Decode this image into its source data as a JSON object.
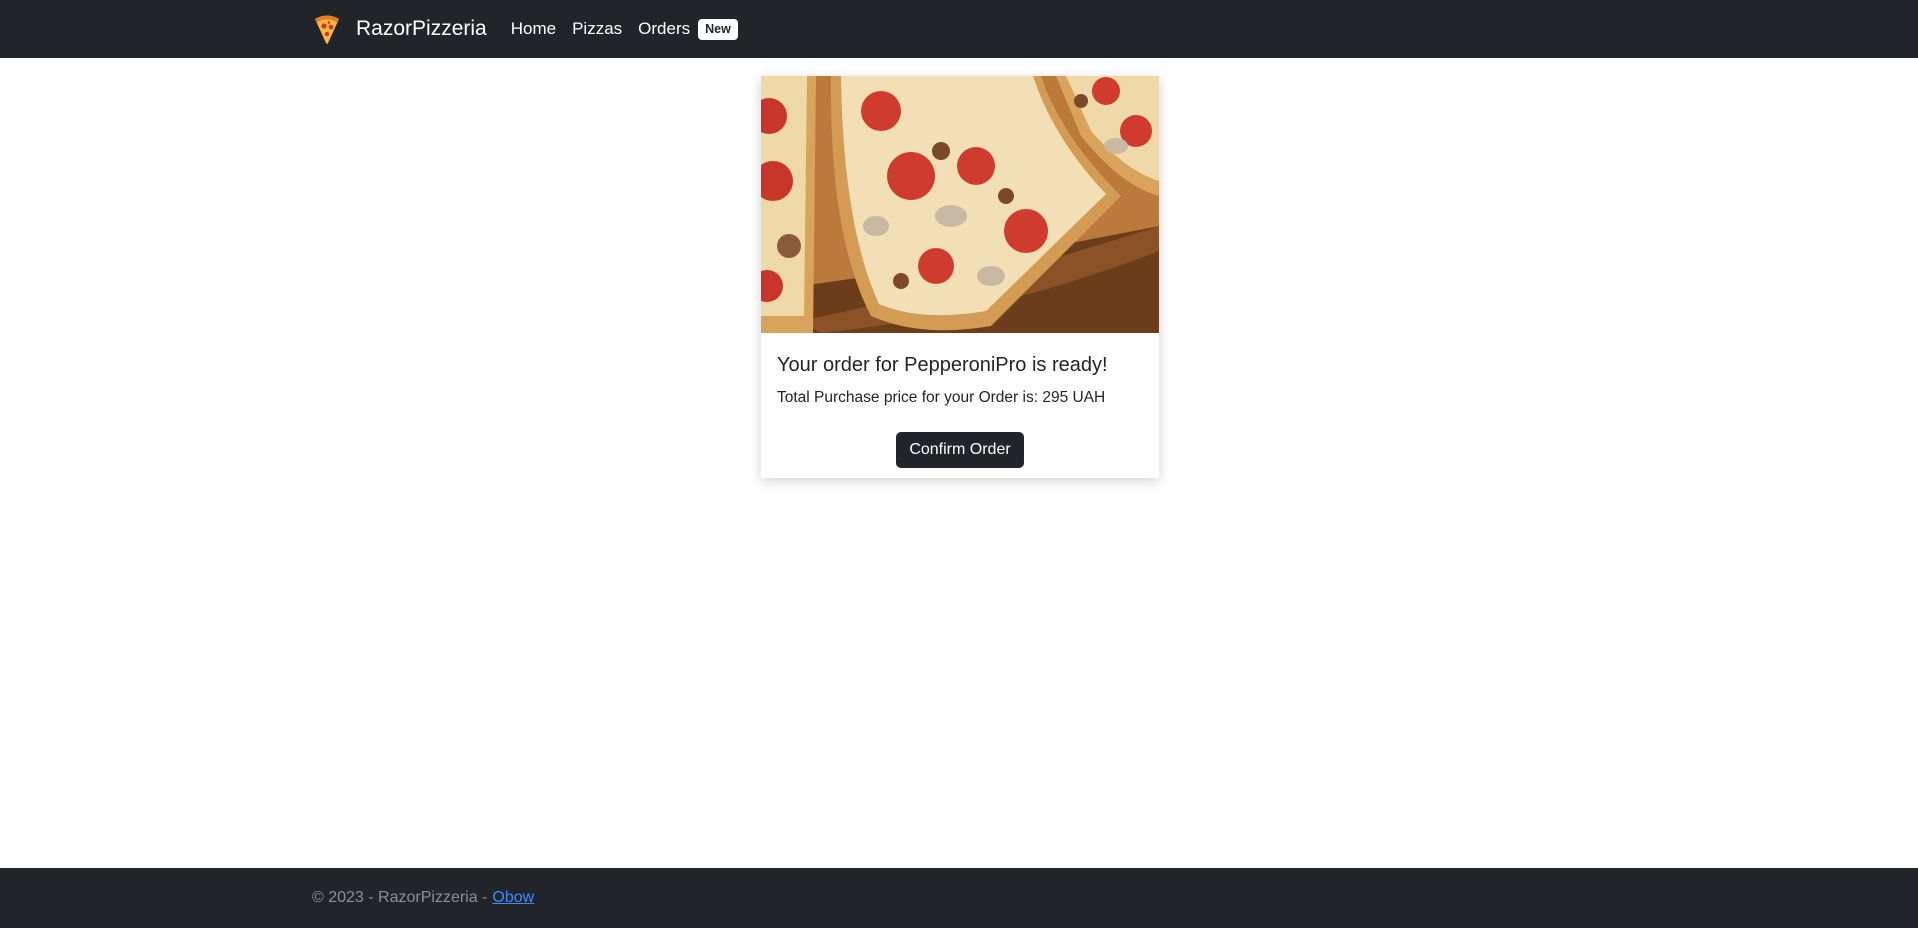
{
  "navbar": {
    "brand_name": "RazorPizzeria",
    "brand_icon": "pizza-slice-icon",
    "links": [
      {
        "label": "Home"
      },
      {
        "label": "Pizzas"
      },
      {
        "label": "Orders"
      }
    ],
    "orders_badge": "New"
  },
  "card": {
    "image": "pizza-photo",
    "title": "Your order for PepperoniPro is ready!",
    "text": "Total Purchase price for your Order is: 295 UAH",
    "confirm_label": "Confirm Order"
  },
  "footer": {
    "text": "© 2023 - RazorPizzeria -",
    "link_label": "Obow"
  },
  "colors": {
    "dark": "#212529",
    "link": "#3b8cff",
    "footer_text": "#8a9096"
  }
}
